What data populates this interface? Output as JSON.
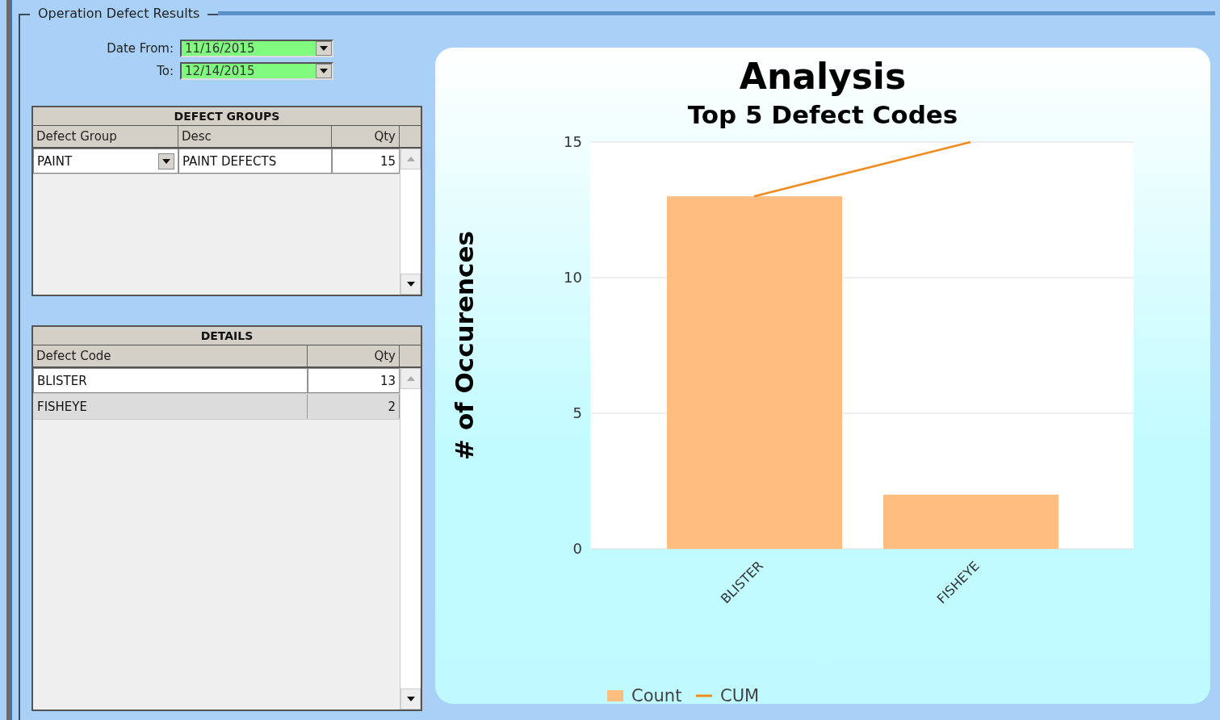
{
  "group_title": "Operation Defect Results",
  "date_from": {
    "label": "Date From:",
    "value": "11/16/2015"
  },
  "date_to": {
    "label": "To:",
    "value": "12/14/2015"
  },
  "defect_groups": {
    "title": "DEFECT GROUPS",
    "columns": [
      "Defect Group",
      "Desc",
      "Qty"
    ],
    "rows": [
      {
        "group": "PAINT",
        "desc": "PAINT DEFECTS",
        "qty": "15",
        "selected": true
      }
    ]
  },
  "details": {
    "title": "DETAILS",
    "columns": [
      "Defect Code",
      "Qty"
    ],
    "rows": [
      {
        "code": "BLISTER",
        "qty": "13",
        "selected": true
      },
      {
        "code": "FISHEYE",
        "qty": "2",
        "selected": false
      }
    ]
  },
  "chart": {
    "title": "Analysis",
    "chart_data": {
      "type": "bar",
      "title": "Top 5 Defect Codes",
      "ylabel": "# of Occurences",
      "categories": [
        "BLISTER",
        "FISHEYE"
      ],
      "series": [
        {
          "name": "Count",
          "type": "bar",
          "color": "#ffbd7f",
          "values": [
            13,
            2
          ]
        },
        {
          "name": "CUM",
          "type": "line",
          "color": "#f08c1e",
          "values": [
            13,
            15
          ]
        }
      ],
      "ylim": [
        0,
        15
      ],
      "legend": "bottom",
      "yticks": [
        0,
        5,
        10,
        15
      ]
    }
  }
}
